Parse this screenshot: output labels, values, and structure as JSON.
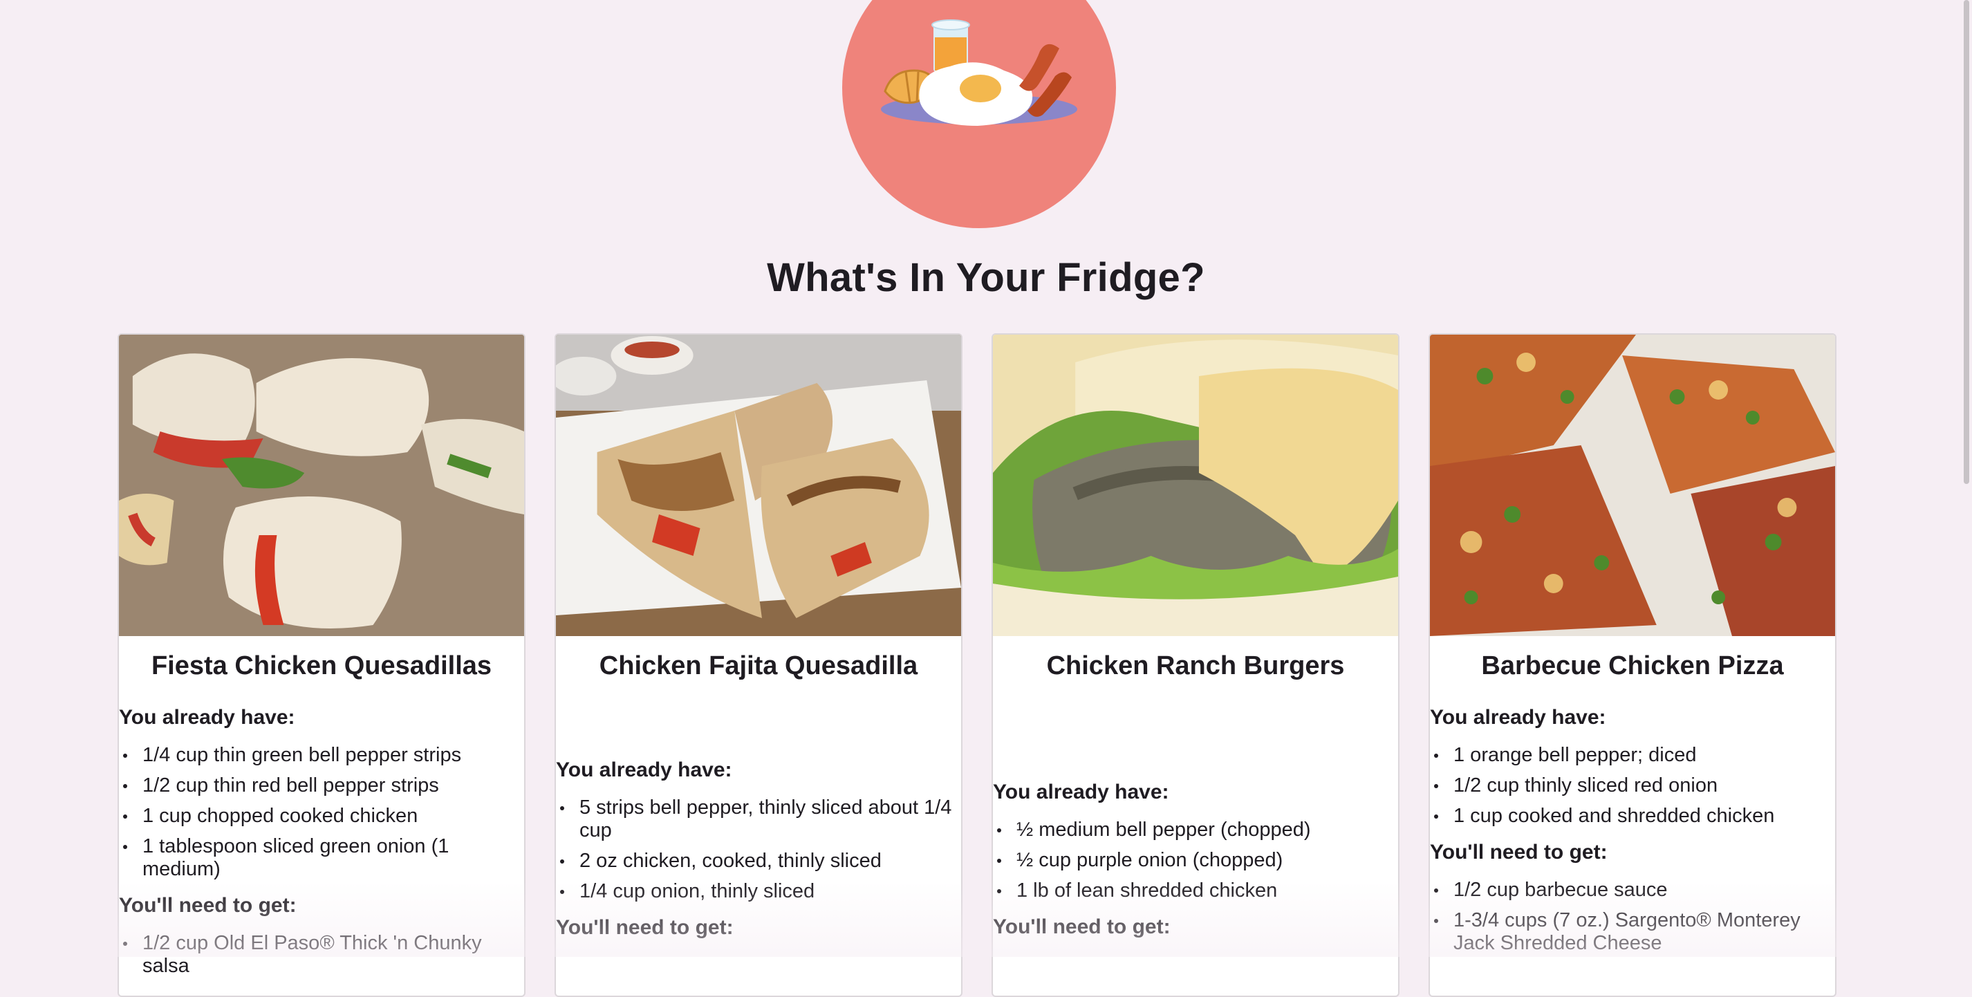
{
  "app": {
    "logo_icon": "breakfast-plate-icon",
    "title": "What's In Your Fridge?",
    "accent_color": "#ef837b",
    "background_color": "#f6eef4"
  },
  "recipes": [
    {
      "title": "Fiesta Chicken Quesadillas",
      "image_icon": "quesadilla-photo",
      "have_heading": "You already have:",
      "have": [
        "1/4 cup thin green bell pepper strips",
        "1/2 cup thin red bell pepper strips",
        "1 cup chopped cooked chicken",
        "1 tablespoon sliced green onion (1 medium)"
      ],
      "need_heading": "You'll need to get:",
      "need": [
        "1/2 cup Old El Paso® Thick 'n Chunky salsa"
      ]
    },
    {
      "title": "Chicken Fajita Quesadilla",
      "image_icon": "fajita-quesadilla-photo",
      "have_heading": "You already have:",
      "have": [
        "5 strips bell pepper, thinly sliced about 1/4 cup",
        "2 oz chicken, cooked, thinly sliced",
        "1/4 cup onion, thinly sliced"
      ],
      "need_heading": "You'll need to get:",
      "need": []
    },
    {
      "title": "Chicken Ranch Burgers",
      "image_icon": "chicken-burger-photo",
      "have_heading": "You already have:",
      "have": [
        "½ medium bell pepper (chopped)",
        "½ cup purple onion (chopped)",
        "1 lb of lean shredded chicken"
      ],
      "need_heading": "You'll need to get:",
      "need": []
    },
    {
      "title": "Barbecue Chicken Pizza",
      "image_icon": "bbq-pizza-photo",
      "have_heading": "You already have:",
      "have": [
        "1 orange bell pepper; diced",
        "1/2 cup thinly sliced red onion",
        "1 cup cooked and shredded chicken"
      ],
      "need_heading": "You'll need to get:",
      "need": [
        "1/2 cup barbecue sauce",
        "1-3/4 cups (7 oz.) Sargento® Monterey Jack Shredded Cheese"
      ]
    }
  ]
}
